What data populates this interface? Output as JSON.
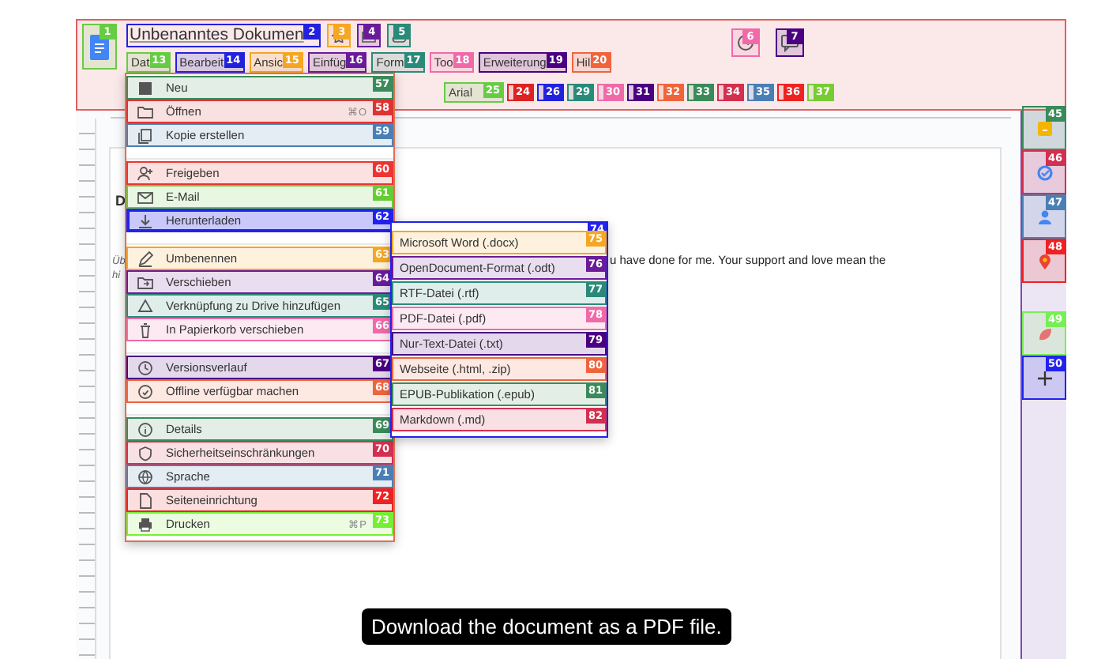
{
  "header": {
    "title": "Unbenanntes Dokumen",
    "doc_badge": {
      "label": "1",
      "color": "#66cc44"
    },
    "title_badge": {
      "label": "2",
      "color": "#2222dd"
    },
    "title_buttons": [
      {
        "badge": "3",
        "color": "#f5a623"
      },
      {
        "badge": "4",
        "color": "#6a1b9a"
      },
      {
        "badge": "5",
        "color": "#2a8a7a"
      }
    ],
    "right_buttons": [
      {
        "badge": "6",
        "color": "#f06aa8"
      },
      {
        "badge": "7",
        "color": "#4b0082"
      }
    ]
  },
  "menubar": [
    {
      "label": "Dat",
      "badge": "13",
      "color": "#66cc44"
    },
    {
      "label": "Bearbeit",
      "badge": "14",
      "color": "#2222dd"
    },
    {
      "label": "Ansic",
      "badge": "15",
      "color": "#f5a623"
    },
    {
      "label": "Einfüg",
      "badge": "16",
      "color": "#6a1b9a"
    },
    {
      "label": "Form",
      "badge": "17",
      "color": "#2a8a7a"
    },
    {
      "label": "Too",
      "badge": "18",
      "color": "#f06aa8"
    },
    {
      "label": "Erweiterung",
      "badge": "19",
      "color": "#4b0082"
    },
    {
      "label": "Hil",
      "badge": "20",
      "color": "#f0643c"
    }
  ],
  "toolbar": {
    "font": "Arial",
    "font_badge": {
      "label": "25",
      "color": "#66cc44"
    },
    "buttons": [
      {
        "badge": "24",
        "color": "#dd2222"
      },
      {
        "badge": "26",
        "color": "#2222dd"
      },
      {
        "badge": "29",
        "color": "#2a8a7a"
      },
      {
        "badge": "30",
        "color": "#f06aa8"
      },
      {
        "badge": "31",
        "color": "#4b0082"
      },
      {
        "badge": "32",
        "color": "#f0643c"
      },
      {
        "badge": "33",
        "color": "#3a8a5a"
      },
      {
        "badge": "34",
        "color": "#d32f4f"
      },
      {
        "badge": "35",
        "color": "#4a7fb5"
      },
      {
        "badge": "36",
        "color": "#ee2222"
      },
      {
        "badge": "37",
        "color": "#77cc33"
      }
    ]
  },
  "document": {
    "heading": "D",
    "side_text": [
      "Üb",
      "hi"
    ],
    "body": "u have done for me. Your support and love mean the"
  },
  "side_panel": [
    {
      "badge": "45",
      "color": "#3a8a5a"
    },
    {
      "badge": "46",
      "color": "#d32f4f"
    },
    {
      "badge": "47",
      "color": "#4a7fb5"
    },
    {
      "badge": "48",
      "color": "#ee2222"
    },
    {
      "badge": "49",
      "color": "#77ee55"
    },
    {
      "badge": "50",
      "color": "#2222ee"
    }
  ],
  "file_menu": {
    "groups": [
      [
        {
          "label": "Neu",
          "badge": "57",
          "color": "#3a8a5a",
          "expanded": false
        },
        {
          "label": "Öffnen",
          "badge": "58",
          "color": "#dd3333",
          "shortcut": "⌘O",
          "expanded": false
        },
        {
          "label": "Kopie erstellen",
          "badge": "59",
          "color": "#4a7fb5",
          "expanded": false
        }
      ],
      [
        {
          "label": "Freigeben",
          "badge": "60",
          "color": "#ee3333",
          "expanded": false
        },
        {
          "label": "E-Mail",
          "badge": "61",
          "color": "#66cc33",
          "expanded": false
        },
        {
          "label": "Herunterladen",
          "badge": "62",
          "color": "#2222ee",
          "expanded": true
        }
      ],
      [
        {
          "label": "Umbenennen",
          "badge": "63",
          "color": "#f5a623",
          "expanded": false
        },
        {
          "label": "Verschieben",
          "badge": "64",
          "color": "#6a1b9a",
          "expanded": false
        },
        {
          "label": "Verknüpfung zu Drive hinzufügen",
          "badge": "65",
          "color": "#2a8a7a",
          "expanded": false
        },
        {
          "label": "In Papierkorb verschieben",
          "badge": "66",
          "color": "#f06aa8",
          "expanded": false
        }
      ],
      [
        {
          "label": "Versionsverlauf",
          "badge": "67",
          "color": "#4b0082",
          "expanded": false
        },
        {
          "label": "Offline verfügbar machen",
          "badge": "68",
          "color": "#f0643c",
          "expanded": false
        }
      ],
      [
        {
          "label": "Details",
          "badge": "69",
          "color": "#3a8a5a",
          "expanded": false
        },
        {
          "label": "Sicherheitseinschränkungen",
          "badge": "70",
          "color": "#d32f4f",
          "expanded": false
        },
        {
          "label": "Sprache",
          "badge": "71",
          "color": "#4a7fb5",
          "expanded": false
        },
        {
          "label": "Seiteneinrichtung",
          "badge": "72",
          "color": "#ee2222",
          "expanded": false
        },
        {
          "label": "Drucken",
          "badge": "73",
          "color": "#77ee33",
          "shortcut": "⌘P",
          "expanded": false
        }
      ]
    ]
  },
  "download_menu": {
    "badge": "74",
    "color": "#2222ee",
    "items": [
      {
        "label": "Microsoft Word (.docx)",
        "badge": "75",
        "color": "#f5a623"
      },
      {
        "label": "OpenDocument-Format (.odt)",
        "badge": "76",
        "color": "#6a1b9a"
      },
      {
        "label": "RTF-Datei (.rtf)",
        "badge": "77",
        "color": "#2a8a7a"
      },
      {
        "label": "PDF-Datei (.pdf)",
        "badge": "78",
        "color": "#f06aa8"
      },
      {
        "label": "Nur-Text-Datei (.txt)",
        "badge": "79",
        "color": "#4b0082"
      },
      {
        "label": "Webseite (.html, .zip)",
        "badge": "80",
        "color": "#f0643c"
      },
      {
        "label": "EPUB-Publikation (.epub)",
        "badge": "81",
        "color": "#3a8a5a"
      },
      {
        "label": "Markdown (.md)",
        "badge": "82",
        "color": "#d32f4f"
      }
    ]
  },
  "caption": "Download the document as a PDF file."
}
